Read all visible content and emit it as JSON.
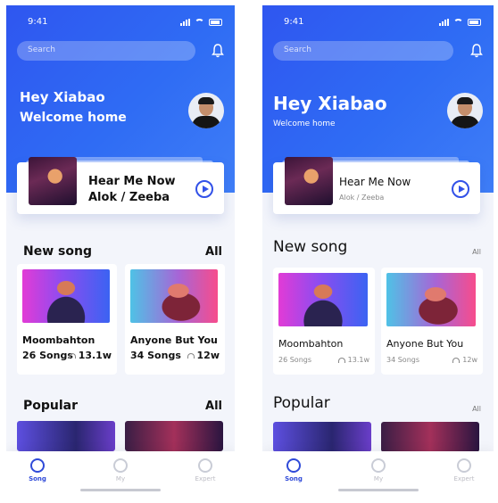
{
  "screens": [
    {
      "status": {
        "time": "9:41"
      },
      "search": {
        "placeholder": "Search"
      },
      "greeting": {
        "line1": "Hey Xiabao",
        "line2": "Welcome home"
      },
      "now_playing": {
        "title": "Hear Me Now",
        "artist": "Alok / Zeeba"
      },
      "new_song": {
        "title": "New song",
        "all": "All",
        "items": [
          {
            "name": "Moombahton",
            "songs": "26 Songs",
            "plays": "13.1w"
          },
          {
            "name": "Anyone But You",
            "songs": "34 Songs",
            "plays": "12w"
          }
        ]
      },
      "popular": {
        "title": "Popular",
        "all": "All"
      },
      "tabs": [
        {
          "label": "Song"
        },
        {
          "label": "My"
        },
        {
          "label": "Expert"
        }
      ]
    },
    {
      "status": {
        "time": "9:41"
      },
      "search": {
        "placeholder": "Search"
      },
      "greeting": {
        "line1": "Hey Xiabao",
        "line2": "Welcome home"
      },
      "now_playing": {
        "title": "Hear Me Now",
        "artist": "Alok / Zeeba"
      },
      "new_song": {
        "title": "New song",
        "all": "All",
        "items": [
          {
            "name": "Moombahton",
            "songs": "26 Songs",
            "plays": "13.1w"
          },
          {
            "name": "Anyone But You",
            "songs": "34 Songs",
            "plays": "12w"
          }
        ]
      },
      "popular": {
        "title": "Popular",
        "all": "All"
      },
      "tabs": [
        {
          "label": "Song"
        },
        {
          "label": "My"
        },
        {
          "label": "Expert"
        }
      ]
    }
  ],
  "colors": {
    "accent": "#2f56f0",
    "active_tab": "#2f4ad8"
  }
}
